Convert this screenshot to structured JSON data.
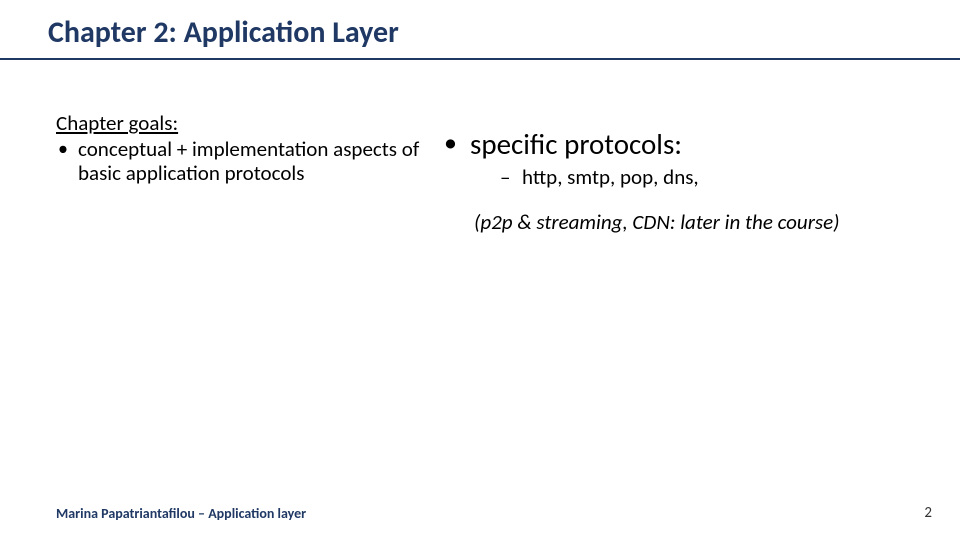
{
  "title": "Chapter 2: Application Layer",
  "left": {
    "heading": "Chapter goals:",
    "bullets": [
      "conceptual + implementation aspects of basic application protocols"
    ]
  },
  "right": {
    "bullets": [
      {
        "text": "specific protocols:",
        "sub": [
          "http, smtp, pop, dns,"
        ]
      }
    ],
    "note": "(p2p & streaming, CDN: later in the course)"
  },
  "footer": {
    "left": "Marina Papatriantafilou –  Application layer",
    "page": "2"
  }
}
